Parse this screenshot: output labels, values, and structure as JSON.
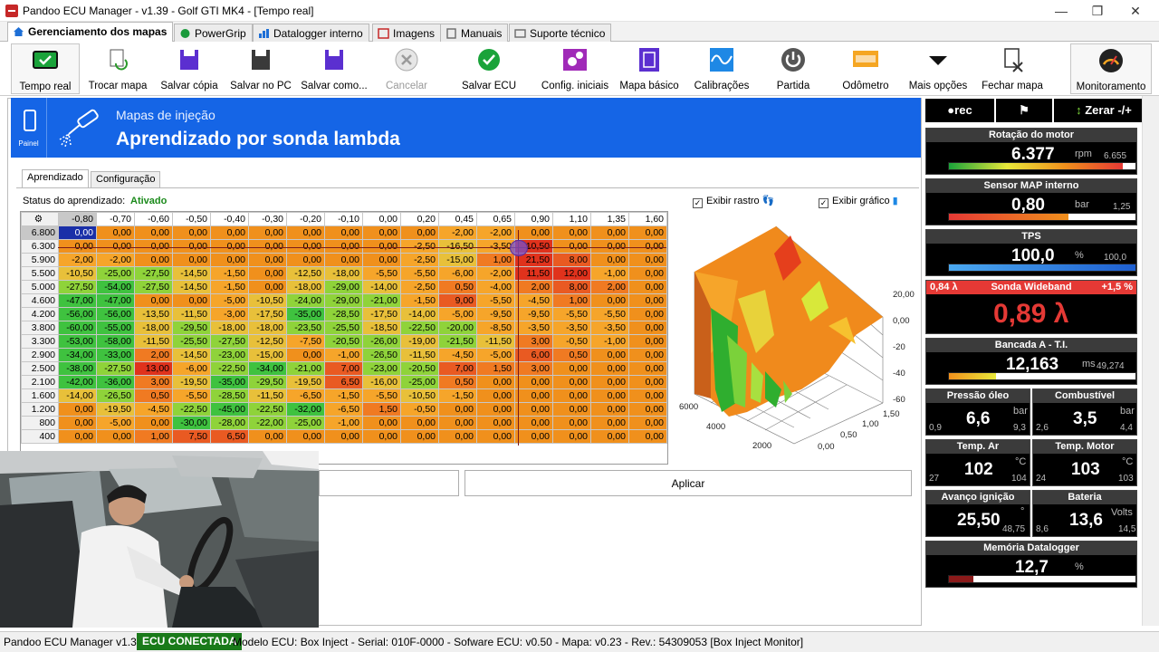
{
  "window": {
    "title": "Pandoo ECU Manager - v1.39 - Golf GTI MK4 - [Tempo real]"
  },
  "main_tabs": [
    "Gerenciamento dos mapas",
    "PowerGrip",
    "Datalogger interno",
    "Imagens",
    "Manuais",
    "Suporte técnico"
  ],
  "toolbar": [
    "Tempo real",
    "Trocar mapa",
    "Salvar cópia",
    "Salvar no PC",
    "Salvar como...",
    "Cancelar",
    "Salvar ECU",
    "Config. iniciais",
    "Mapa básico",
    "Calibrações",
    "Partida",
    "Odômetro",
    "Mais opções",
    "Fechar mapa",
    "Monitoramento"
  ],
  "banner": {
    "panel": "Painel",
    "subtitle": "Mapas de injeção",
    "title": "Aprendizado por sonda lambda"
  },
  "subtabs": [
    "Aprendizado",
    "Configuração"
  ],
  "status": {
    "label": "Status do aprendizado:",
    "value": "Ativado"
  },
  "options": {
    "trail": "Exibir rastro",
    "graph": "Exibir gráfico"
  },
  "grid": {
    "columns": [
      "-0,80",
      "-0,70",
      "-0,60",
      "-0,50",
      "-0,40",
      "-0,30",
      "-0,20",
      "-0,10",
      "0,00",
      "0,20",
      "0,45",
      "0,65",
      "0,90",
      "1,10",
      "1,35",
      "1,60"
    ],
    "rows": [
      {
        "rpm": "6.800",
        "v": [
          "0,00",
          "0,00",
          "0,00",
          "0,00",
          "0,00",
          "0,00",
          "0,00",
          "0,00",
          "0,00",
          "0,00",
          "-2,00",
          "-2,00",
          "0,00",
          "0,00",
          "0,00",
          "0,00"
        ]
      },
      {
        "rpm": "6.300",
        "v": [
          "0,00",
          "0,00",
          "0,00",
          "0,00",
          "0,00",
          "0,00",
          "0,00",
          "0,00",
          "0,00",
          "-2,50",
          "-16,50",
          "-3,50",
          "10,50",
          "0,00",
          "0,00",
          "0,00"
        ]
      },
      {
        "rpm": "5.900",
        "v": [
          "-2,00",
          "-2,00",
          "0,00",
          "0,00",
          "0,00",
          "0,00",
          "0,00",
          "0,00",
          "0,00",
          "-2,50",
          "-15,00",
          "1,00",
          "21,50",
          "8,00",
          "0,00",
          "0,00"
        ]
      },
      {
        "rpm": "5.500",
        "v": [
          "-10,50",
          "-25,00",
          "-27,50",
          "-14,50",
          "-1,50",
          "0,00",
          "-12,50",
          "-18,00",
          "-5,50",
          "-5,50",
          "-6,00",
          "-2,00",
          "11,50",
          "12,00",
          "-1,00",
          "0,00"
        ]
      },
      {
        "rpm": "5.000",
        "v": [
          "-27,50",
          "-54,00",
          "-27,50",
          "-14,50",
          "-1,50",
          "0,00",
          "-18,00",
          "-29,00",
          "-14,00",
          "-2,50",
          "0,50",
          "-4,00",
          "2,00",
          "8,00",
          "2,00",
          "0,00"
        ]
      },
      {
        "rpm": "4.600",
        "v": [
          "-47,00",
          "-47,00",
          "0,00",
          "0,00",
          "-5,00",
          "-10,50",
          "-24,00",
          "-29,00",
          "-21,00",
          "-1,50",
          "9,00",
          "-5,50",
          "-4,50",
          "1,00",
          "0,00",
          "0,00"
        ]
      },
      {
        "rpm": "4.200",
        "v": [
          "-56,00",
          "-56,00",
          "-13,50",
          "-11,50",
          "-3,00",
          "-17,50",
          "-35,00",
          "-28,50",
          "-17,50",
          "-14,00",
          "-5,00",
          "-9,50",
          "-9,50",
          "-5,50",
          "-5,50",
          "0,00"
        ]
      },
      {
        "rpm": "3.800",
        "v": [
          "-60,00",
          "-55,00",
          "-18,00",
          "-29,50",
          "-18,00",
          "-18,00",
          "-23,50",
          "-25,50",
          "-18,50",
          "-22,50",
          "-20,00",
          "-8,50",
          "-3,50",
          "-3,50",
          "-3,50",
          "0,00"
        ]
      },
      {
        "rpm": "3.300",
        "v": [
          "-53,00",
          "-58,00",
          "-11,50",
          "-25,50",
          "-27,50",
          "-12,50",
          "-7,50",
          "-20,50",
          "-26,00",
          "-19,00",
          "-21,50",
          "-11,50",
          "3,00",
          "-0,50",
          "-1,00",
          "0,00"
        ]
      },
      {
        "rpm": "2.900",
        "v": [
          "-34,00",
          "-33,00",
          "2,00",
          "-14,50",
          "-23,00",
          "-15,00",
          "0,00",
          "-1,00",
          "-26,50",
          "-11,50",
          "-4,50",
          "-5,00",
          "6,00",
          "0,50",
          "0,00",
          "0,00"
        ]
      },
      {
        "rpm": "2.500",
        "v": [
          "-38,00",
          "-27,50",
          "13,00",
          "-6,00",
          "-22,50",
          "-34,00",
          "-21,00",
          "7,00",
          "-23,00",
          "-20,50",
          "7,00",
          "1,50",
          "3,00",
          "0,00",
          "0,00",
          "0,00"
        ]
      },
      {
        "rpm": "2.100",
        "v": [
          "-42,00",
          "-36,00",
          "3,00",
          "-19,50",
          "-35,00",
          "-29,50",
          "-19,50",
          "6,50",
          "-16,00",
          "-25,00",
          "0,50",
          "0,00",
          "0,00",
          "0,00",
          "0,00",
          "0,00"
        ]
      },
      {
        "rpm": "1.600",
        "v": [
          "-14,00",
          "-26,50",
          "0,50",
          "-5,50",
          "-28,50",
          "-11,50",
          "-6,50",
          "-1,50",
          "-5,50",
          "-10,50",
          "-1,50",
          "0,00",
          "0,00",
          "0,00",
          "0,00",
          "0,00"
        ]
      },
      {
        "rpm": "1.200",
        "v": [
          "0,00",
          "-19,50",
          "-4,50",
          "-22,50",
          "-45,00",
          "-22,50",
          "-32,00",
          "-6,50",
          "1,50",
          "-0,50",
          "0,00",
          "0,00",
          "0,00",
          "0,00",
          "0,00",
          "0,00"
        ]
      },
      {
        "rpm": "800",
        "v": [
          "0,00",
          "-5,00",
          "0,00",
          "-30,00",
          "-28,00",
          "-22,00",
          "-25,00",
          "-1,00",
          "0,00",
          "0,00",
          "0,00",
          "0,00",
          "0,00",
          "0,00",
          "0,00",
          "0,00"
        ]
      },
      {
        "rpm": "400",
        "v": [
          "0,00",
          "0,00",
          "1,00",
          "7,50",
          "6,50",
          "0,00",
          "0,00",
          "0,00",
          "0,00",
          "0,00",
          "0,00",
          "0,00",
          "0,00",
          "0,00",
          "0,00",
          "0,00"
        ]
      }
    ]
  },
  "plot": {
    "z": [
      "20,00",
      "0,00",
      "-20",
      "-40",
      "-60"
    ],
    "y": [
      "6000",
      "4000",
      "2000"
    ],
    "x": [
      "0,00",
      "0,50",
      "1,00",
      "1,50"
    ]
  },
  "apply": "Aplicar",
  "rtools": {
    "rec": "rec",
    "zero": "Zerar -/+"
  },
  "gauges": {
    "rpm": {
      "title": "Rotação do motor",
      "value": "6.377",
      "unit": "rpm",
      "max": "6.655",
      "fill": 0.93
    },
    "map": {
      "title": "Sensor MAP interno",
      "value": "0,80",
      "unit": "bar",
      "max": "1,25",
      "fill": 0.64
    },
    "tps": {
      "title": "TPS",
      "value": "100,0",
      "unit": "%",
      "max": "100,0",
      "fill": 1.0
    },
    "lambda": {
      "title": "Sonda Wideband",
      "left": "0,84 λ",
      "right": "+1,5 %",
      "value": "0,89 λ"
    },
    "bank": {
      "title": "Bancada A - T.I.",
      "value": "12,163",
      "unit": "ms",
      "max": "49,274",
      "fill": 0.25
    },
    "oil": {
      "title": "Pressão óleo",
      "value": "6,6",
      "unit": "bar",
      "min": "0,9",
      "max": "9,3"
    },
    "fuel": {
      "title": "Combustível",
      "value": "3,5",
      "unit": "bar",
      "min": "2,6",
      "max": "4,4"
    },
    "air": {
      "title": "Temp. Ar",
      "value": "102",
      "unit": "°C",
      "min": "27",
      "max": "104"
    },
    "eng": {
      "title": "Temp. Motor",
      "value": "103",
      "unit": "°C",
      "min": "24",
      "max": "103"
    },
    "adv": {
      "title": "Avanço ignição",
      "value": "25,50",
      "unit": "°",
      "max": "48,75"
    },
    "bat": {
      "title": "Bateria",
      "value": "13,6",
      "unit": "Volts",
      "min": "8,6",
      "max": "14,5"
    },
    "mem": {
      "title": "Memória Datalogger",
      "value": "12,7",
      "unit": "%",
      "fill": 0.13
    }
  },
  "statusbar": {
    "app": "Pandoo ECU Manager v1.39",
    "conn": "ECU CONECTADA",
    "info": "Modelo ECU: Box Inject - Serial: 010F-0000 - Sofware ECU: v0.50 - Mapa: v0.23 - Rev.: 54309053 [Box Inject Monitor]"
  }
}
